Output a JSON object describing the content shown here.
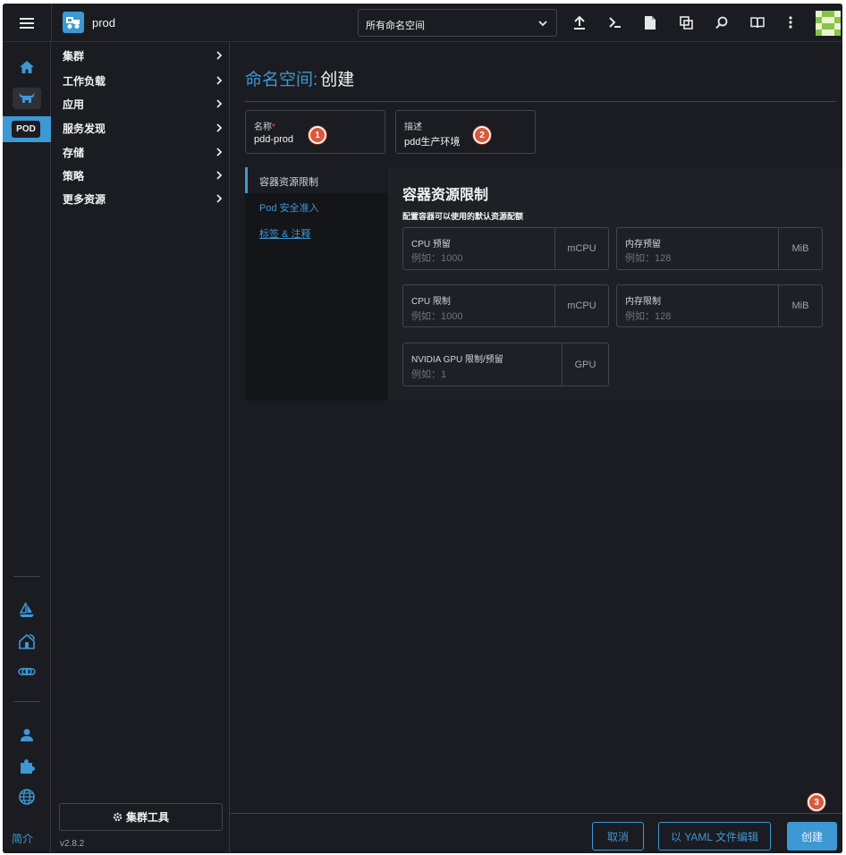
{
  "topbar": {
    "cluster_name": "prod",
    "namespace_select": "所有命名空间"
  },
  "rail": {
    "pod_label": "POD",
    "about_label": "简介"
  },
  "nav": {
    "items": [
      {
        "label": "集群"
      },
      {
        "label": "工作负载"
      },
      {
        "label": "应用"
      },
      {
        "label": "服务发现"
      },
      {
        "label": "存储"
      },
      {
        "label": "策略"
      },
      {
        "label": "更多资源"
      }
    ],
    "cluster_tools_label": "集群工具",
    "version": "v2.8.2"
  },
  "page": {
    "title_prefix": "命名空间:",
    "title_action": "创建"
  },
  "form": {
    "name": {
      "label": "名称",
      "required_mark": "*",
      "value": "pdd-prod",
      "badge": "1"
    },
    "description": {
      "label": "描述",
      "value": "pdd生产环境",
      "badge": "2"
    }
  },
  "tabs": [
    {
      "label": "容器资源限制"
    },
    {
      "label": "Pod 安全准入"
    },
    {
      "label": "标签 & 注释"
    }
  ],
  "limits": {
    "heading": "容器资源限制",
    "subheading": "配置容器可以使用的默认资源配额",
    "cpu_reservation": {
      "label": "CPU 预留",
      "placeholder": "例如：1000",
      "unit": "mCPU"
    },
    "memory_reservation": {
      "label": "内存预留",
      "placeholder": "例如：128",
      "unit": "MiB"
    },
    "cpu_limit": {
      "label": "CPU 限制",
      "placeholder": "例如：1000",
      "unit": "mCPU"
    },
    "memory_limit": {
      "label": "内存限制",
      "placeholder": "例如：128",
      "unit": "MiB"
    },
    "gpu": {
      "label": "NVIDIA GPU 限制/预留",
      "placeholder": "例如：1",
      "unit": "GPU"
    }
  },
  "footer": {
    "cancel_label": "取消",
    "yaml_label": "以 YAML 文件编辑",
    "create_label": "创建",
    "create_badge": "3"
  },
  "colors": {
    "accent": "#3d98d3",
    "background": "#1b1c21",
    "badge": "#d9593a"
  }
}
